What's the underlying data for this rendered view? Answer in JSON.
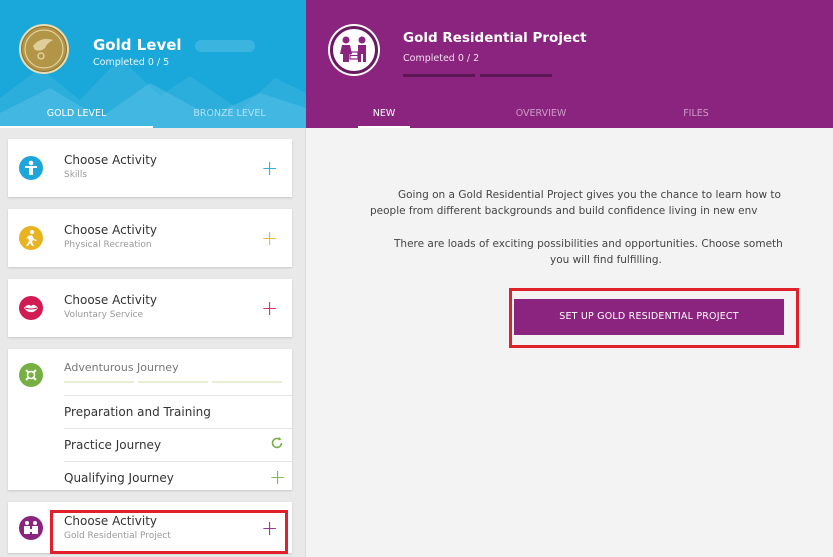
{
  "left_header": {
    "title": "Gold Level",
    "subtitle": "Completed 0 / 5",
    "tabs": [
      {
        "label": "GOLD LEVEL",
        "active": true
      },
      {
        "label": "BRONZE LEVEL",
        "active": false
      }
    ]
  },
  "right_header": {
    "title": "Gold Residential Project",
    "subtitle": "Completed 0 / 2",
    "tabs": [
      {
        "label": "NEW",
        "active": true
      },
      {
        "label": "OVERVIEW",
        "active": false
      },
      {
        "label": "FILES",
        "active": false
      }
    ]
  },
  "sections": [
    {
      "name": "Choose Activity",
      "category": "Skills",
      "color": "#1ea6da",
      "icon": "person-skills-icon"
    },
    {
      "name": "Choose Activity",
      "category": "Physical Recreation",
      "color": "#e8b320",
      "icon": "running-person-icon"
    },
    {
      "name": "Choose Activity",
      "category": "Voluntary Service",
      "color": "#d31b53",
      "icon": "lips-heart-icon"
    },
    {
      "name": "Adventurous Journey",
      "color": "#76b043",
      "icon": "compass-hike-icon",
      "subitems": [
        {
          "label": "Preparation and Training",
          "action": "none"
        },
        {
          "label": "Practice Journey",
          "action": "refresh-icon"
        },
        {
          "label": "Qualifying Journey",
          "action": "plus-icon"
        }
      ]
    },
    {
      "name": "Choose Activity",
      "category": "Gold Residential Project",
      "color": "#8a247e",
      "icon": "residential-people-icon"
    }
  ],
  "content": {
    "paragraph1_line1": "Going on a Gold Residential Project gives you the chance to learn how to",
    "paragraph1_line2": "people from different backgrounds and build confidence living in new env",
    "paragraph2_line1": "There are loads of exciting possibilities and opportunities. Choose someth",
    "paragraph2_line2": "you will find fulfilling.",
    "button_label": "SET UP GOLD RESIDENTIAL PROJECT"
  },
  "colors": {
    "gold_header": "#1aa7d9",
    "residential_header": "#8a247e",
    "highlight": "#e0202a"
  }
}
